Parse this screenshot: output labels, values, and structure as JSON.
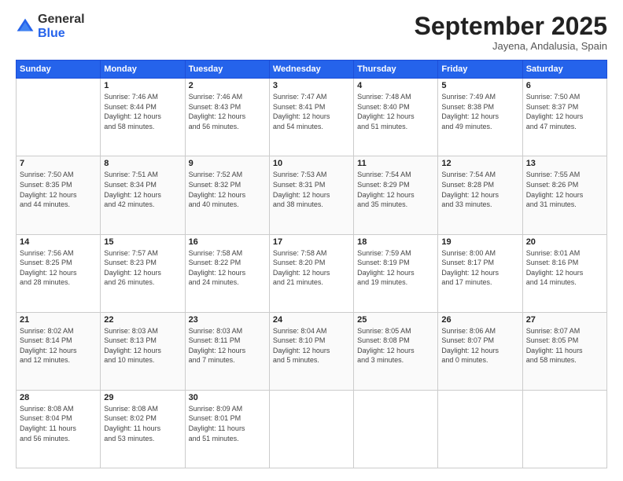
{
  "logo": {
    "general": "General",
    "blue": "Blue"
  },
  "title": "September 2025",
  "subtitle": "Jayena, Andalusia, Spain",
  "days_of_week": [
    "Sunday",
    "Monday",
    "Tuesday",
    "Wednesday",
    "Thursday",
    "Friday",
    "Saturday"
  ],
  "weeks": [
    [
      {
        "day": "",
        "info": ""
      },
      {
        "day": "1",
        "info": "Sunrise: 7:46 AM\nSunset: 8:44 PM\nDaylight: 12 hours\nand 58 minutes."
      },
      {
        "day": "2",
        "info": "Sunrise: 7:46 AM\nSunset: 8:43 PM\nDaylight: 12 hours\nand 56 minutes."
      },
      {
        "day": "3",
        "info": "Sunrise: 7:47 AM\nSunset: 8:41 PM\nDaylight: 12 hours\nand 54 minutes."
      },
      {
        "day": "4",
        "info": "Sunrise: 7:48 AM\nSunset: 8:40 PM\nDaylight: 12 hours\nand 51 minutes."
      },
      {
        "day": "5",
        "info": "Sunrise: 7:49 AM\nSunset: 8:38 PM\nDaylight: 12 hours\nand 49 minutes."
      },
      {
        "day": "6",
        "info": "Sunrise: 7:50 AM\nSunset: 8:37 PM\nDaylight: 12 hours\nand 47 minutes."
      }
    ],
    [
      {
        "day": "7",
        "info": "Sunrise: 7:50 AM\nSunset: 8:35 PM\nDaylight: 12 hours\nand 44 minutes."
      },
      {
        "day": "8",
        "info": "Sunrise: 7:51 AM\nSunset: 8:34 PM\nDaylight: 12 hours\nand 42 minutes."
      },
      {
        "day": "9",
        "info": "Sunrise: 7:52 AM\nSunset: 8:32 PM\nDaylight: 12 hours\nand 40 minutes."
      },
      {
        "day": "10",
        "info": "Sunrise: 7:53 AM\nSunset: 8:31 PM\nDaylight: 12 hours\nand 38 minutes."
      },
      {
        "day": "11",
        "info": "Sunrise: 7:54 AM\nSunset: 8:29 PM\nDaylight: 12 hours\nand 35 minutes."
      },
      {
        "day": "12",
        "info": "Sunrise: 7:54 AM\nSunset: 8:28 PM\nDaylight: 12 hours\nand 33 minutes."
      },
      {
        "day": "13",
        "info": "Sunrise: 7:55 AM\nSunset: 8:26 PM\nDaylight: 12 hours\nand 31 minutes."
      }
    ],
    [
      {
        "day": "14",
        "info": "Sunrise: 7:56 AM\nSunset: 8:25 PM\nDaylight: 12 hours\nand 28 minutes."
      },
      {
        "day": "15",
        "info": "Sunrise: 7:57 AM\nSunset: 8:23 PM\nDaylight: 12 hours\nand 26 minutes."
      },
      {
        "day": "16",
        "info": "Sunrise: 7:58 AM\nSunset: 8:22 PM\nDaylight: 12 hours\nand 24 minutes."
      },
      {
        "day": "17",
        "info": "Sunrise: 7:58 AM\nSunset: 8:20 PM\nDaylight: 12 hours\nand 21 minutes."
      },
      {
        "day": "18",
        "info": "Sunrise: 7:59 AM\nSunset: 8:19 PM\nDaylight: 12 hours\nand 19 minutes."
      },
      {
        "day": "19",
        "info": "Sunrise: 8:00 AM\nSunset: 8:17 PM\nDaylight: 12 hours\nand 17 minutes."
      },
      {
        "day": "20",
        "info": "Sunrise: 8:01 AM\nSunset: 8:16 PM\nDaylight: 12 hours\nand 14 minutes."
      }
    ],
    [
      {
        "day": "21",
        "info": "Sunrise: 8:02 AM\nSunset: 8:14 PM\nDaylight: 12 hours\nand 12 minutes."
      },
      {
        "day": "22",
        "info": "Sunrise: 8:03 AM\nSunset: 8:13 PM\nDaylight: 12 hours\nand 10 minutes."
      },
      {
        "day": "23",
        "info": "Sunrise: 8:03 AM\nSunset: 8:11 PM\nDaylight: 12 hours\nand 7 minutes."
      },
      {
        "day": "24",
        "info": "Sunrise: 8:04 AM\nSunset: 8:10 PM\nDaylight: 12 hours\nand 5 minutes."
      },
      {
        "day": "25",
        "info": "Sunrise: 8:05 AM\nSunset: 8:08 PM\nDaylight: 12 hours\nand 3 minutes."
      },
      {
        "day": "26",
        "info": "Sunrise: 8:06 AM\nSunset: 8:07 PM\nDaylight: 12 hours\nand 0 minutes."
      },
      {
        "day": "27",
        "info": "Sunrise: 8:07 AM\nSunset: 8:05 PM\nDaylight: 11 hours\nand 58 minutes."
      }
    ],
    [
      {
        "day": "28",
        "info": "Sunrise: 8:08 AM\nSunset: 8:04 PM\nDaylight: 11 hours\nand 56 minutes."
      },
      {
        "day": "29",
        "info": "Sunrise: 8:08 AM\nSunset: 8:02 PM\nDaylight: 11 hours\nand 53 minutes."
      },
      {
        "day": "30",
        "info": "Sunrise: 8:09 AM\nSunset: 8:01 PM\nDaylight: 11 hours\nand 51 minutes."
      },
      {
        "day": "",
        "info": ""
      },
      {
        "day": "",
        "info": ""
      },
      {
        "day": "",
        "info": ""
      },
      {
        "day": "",
        "info": ""
      }
    ]
  ]
}
